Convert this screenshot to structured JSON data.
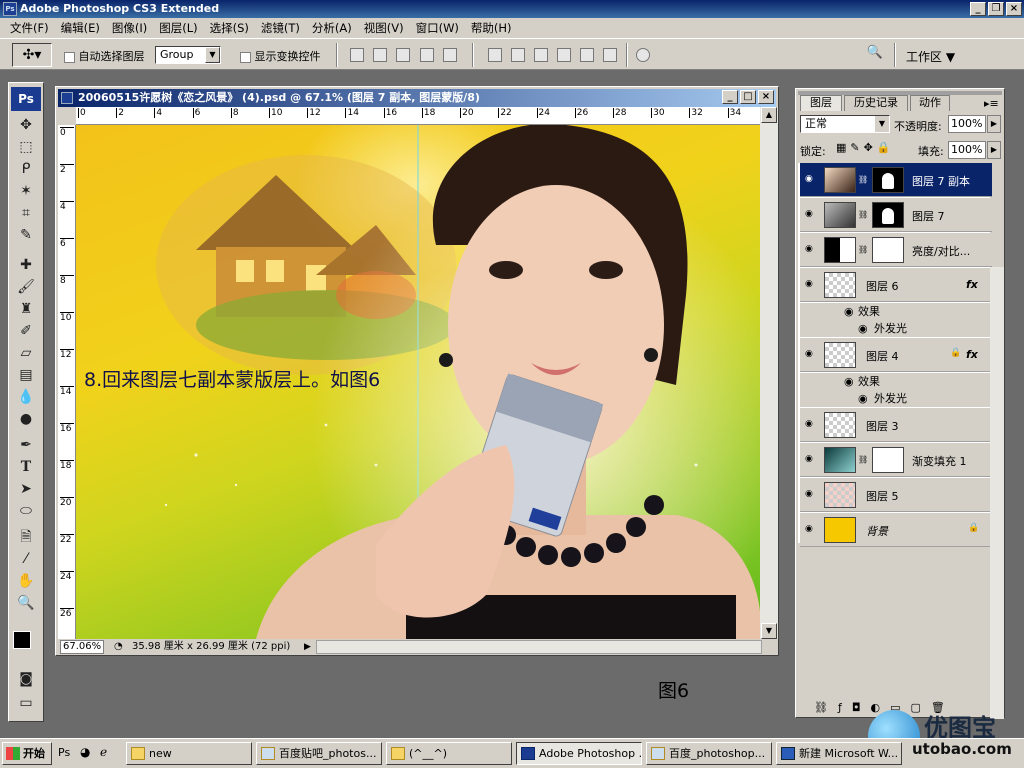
{
  "app": {
    "title": "Adobe Photoshop CS3 Extended",
    "brand_color": "#1a3b8f"
  },
  "menu": [
    "文件(F)",
    "编辑(E)",
    "图像(I)",
    "图层(L)",
    "选择(S)",
    "滤镜(T)",
    "分析(A)",
    "视图(V)",
    "窗口(W)",
    "帮助(H)"
  ],
  "options": {
    "auto_select_label": "自动选择图层",
    "group_value": "Group",
    "show_transform_label": "显示变换控件",
    "workspace_label": "工作区 ▼"
  },
  "document": {
    "title": "20060515许愿树《恋之风景》 (4).psd @ 67.1% (图层 7 副本, 图层蒙版/8)",
    "hruler": [
      "0",
      "2",
      "4",
      "6",
      "8",
      "10",
      "12",
      "14",
      "16",
      "18",
      "20",
      "22",
      "24",
      "26",
      "28",
      "30",
      "32",
      "34"
    ],
    "vruler": [
      "0",
      "2",
      "4",
      "6",
      "8",
      "10",
      "12",
      "14",
      "16",
      "18",
      "20",
      "22",
      "24",
      "26"
    ],
    "overlay_text": "8.回来图层七副本蒙版层上。如图6",
    "zoom": "67.06%",
    "size_info": "35.98 厘米 x 26.99 厘米 (72 ppi)"
  },
  "caption": "图6",
  "layers_panel": {
    "tabs": [
      "图层",
      "历史记录",
      "动作"
    ],
    "blend_mode": "正常",
    "opacity_label": "不透明度:",
    "opacity_value": "100%",
    "lock_label": "锁定:",
    "fill_label": "填充:",
    "fill_value": "100%",
    "layers": [
      {
        "name": "图层 7 副本",
        "selected": true,
        "thumb": "photo",
        "mask": "black-silhouette"
      },
      {
        "name": "图层 7",
        "selected": false,
        "thumb": "photo-gray",
        "mask": "black-silhouette"
      },
      {
        "name": "亮度/对比...",
        "selected": false,
        "thumb": "adjustment",
        "mask": "white"
      },
      {
        "name": "图层 6",
        "selected": false,
        "thumb": "transparent",
        "fx": "fx",
        "effects": [
          "效果",
          "外发光"
        ]
      },
      {
        "name": "图层 4",
        "selected": false,
        "thumb": "transparent",
        "fx": "fx",
        "effects": [
          "效果",
          "外发光"
        ]
      },
      {
        "name": "图层 3",
        "selected": false,
        "thumb": "transparent"
      },
      {
        "name": "渐变填充 1",
        "selected": false,
        "thumb": "gradient",
        "mask": "white"
      },
      {
        "name": "图层 5",
        "selected": false,
        "thumb": "transparent-red"
      },
      {
        "name": "背景",
        "selected": false,
        "thumb": "yellow",
        "locked": true
      }
    ]
  },
  "taskbar": {
    "start": "开始",
    "tasks": [
      "new",
      "百度贴吧_photos...",
      "(^__^)",
      "Adobe Photoshop ...",
      "百度_photoshop...",
      "新建 Microsoft W..."
    ]
  },
  "watermark": {
    "cn": "优图宝",
    "en": "utobao.com"
  }
}
